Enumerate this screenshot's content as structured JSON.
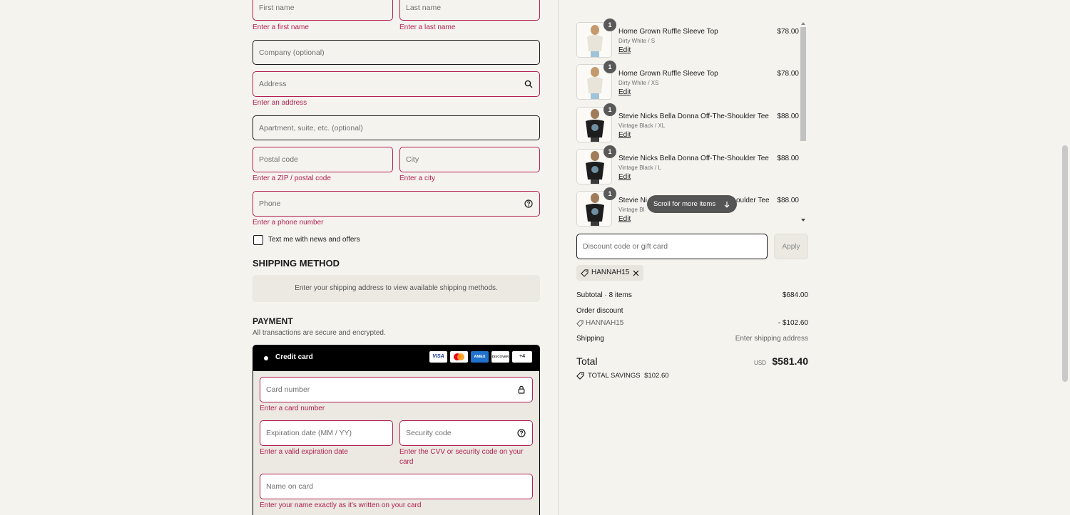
{
  "contact": {
    "first_name_ph": "First name",
    "last_name_ph": "Last name",
    "first_name_err": "Enter a first name",
    "last_name_err": "Enter a last name",
    "company_ph": "Company (optional)",
    "address_ph": "Address",
    "address_err": "Enter an address",
    "apartment_ph": "Apartment, suite, etc. (optional)",
    "postal_ph": "Postal code",
    "postal_err": "Enter a ZIP / postal code",
    "city_ph": "City",
    "city_err": "Enter a city",
    "phone_ph": "Phone",
    "phone_err": "Enter a phone number",
    "sms_label": "Text me with news and offers"
  },
  "shipping": {
    "heading": "SHIPPING METHOD",
    "notice": "Enter your shipping address to view available shipping methods."
  },
  "payment": {
    "heading": "PAYMENT",
    "subtext": "All transactions are secure and encrypted.",
    "method_label": "Credit card",
    "cards": [
      "VISA",
      "MC",
      "AMEX",
      "DISCOVER",
      "+4"
    ],
    "card_number_ph": "Card number",
    "card_number_err": "Enter a card number",
    "expiry_ph": "Expiration date (MM / YY)",
    "expiry_err": "Enter a valid expiration date",
    "cvv_ph": "Security code",
    "cvv_err_1": "Enter the CVV or security code on your",
    "cvv_err_2": "card",
    "name_ph": "Name on card",
    "name_err": "Enter your name exactly as it's written on your card"
  },
  "cart": {
    "items": [
      {
        "qty": "1",
        "name": "Home Grown Ruffle Sleeve Top",
        "variant": "Dirty White / S",
        "price": "$78.00",
        "edit": "Edit"
      },
      {
        "qty": "1",
        "name": "Home Grown Ruffle Sleeve Top",
        "variant": "Dirty White / XS",
        "price": "$78.00",
        "edit": "Edit"
      },
      {
        "qty": "1",
        "name": "Stevie Nicks Bella Donna Off-The-Shoulder Tee",
        "variant": "Vintage Black / XL",
        "price": "$88.00",
        "edit": "Edit"
      },
      {
        "qty": "1",
        "name": "Stevie Nicks Bella Donna Off-The-Shoulder Tee",
        "variant": "Vintage Black / L",
        "price": "$88.00",
        "edit": "Edit"
      },
      {
        "qty": "1",
        "name": "Stevie Ni",
        "name_tail": "oulder Tee",
        "variant": "Vintage Bl",
        "price": "$88.00",
        "edit": "Edit"
      }
    ],
    "scroll_hint": "Scroll for more items",
    "discount_ph": "Discount code or gift card",
    "apply_label": "Apply",
    "applied_code": "HANNAH15"
  },
  "summary": {
    "subtotal_label": "Subtotal · 8 items",
    "subtotal_value": "$684.00",
    "order_discount_label": "Order discount",
    "discount_code": "HANNAH15",
    "discount_value": "- $102.60",
    "shipping_label": "Shipping",
    "shipping_value": "Enter shipping address",
    "total_label": "Total",
    "currency": "USD",
    "total_value": "$581.40",
    "savings_label": "TOTAL SAVINGS",
    "savings_value": "$102.60"
  },
  "colors": {
    "error": "#b21f52",
    "background": "#f5f3ee",
    "payment_header": "#000000"
  }
}
